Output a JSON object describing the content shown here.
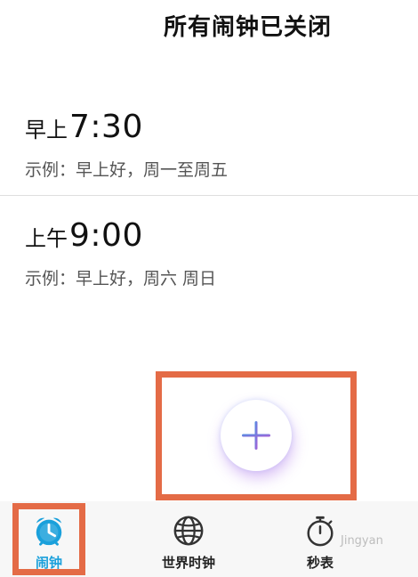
{
  "header": {
    "title": "所有闹钟已关闭"
  },
  "alarms": [
    {
      "period": "早上",
      "time": "7:30",
      "description": "示例：早上好，周一至周五"
    },
    {
      "period": "上午",
      "time": "9:00",
      "description": "示例：早上好，周六 周日"
    }
  ],
  "fab": {
    "icon": "plus-icon"
  },
  "bottom_nav": {
    "items": [
      {
        "label": "闹钟",
        "icon": "alarm-clock-icon",
        "active": true
      },
      {
        "label": "世界时钟",
        "icon": "globe-icon",
        "active": false
      },
      {
        "label": "秒表",
        "icon": "stopwatch-icon",
        "active": false
      }
    ]
  },
  "watermark": "Jingyan",
  "colors": {
    "accent": "#1aa0db",
    "highlight": "#e46b46",
    "fab_plus_start": "#4a90e2",
    "fab_plus_end": "#b05cd6"
  }
}
